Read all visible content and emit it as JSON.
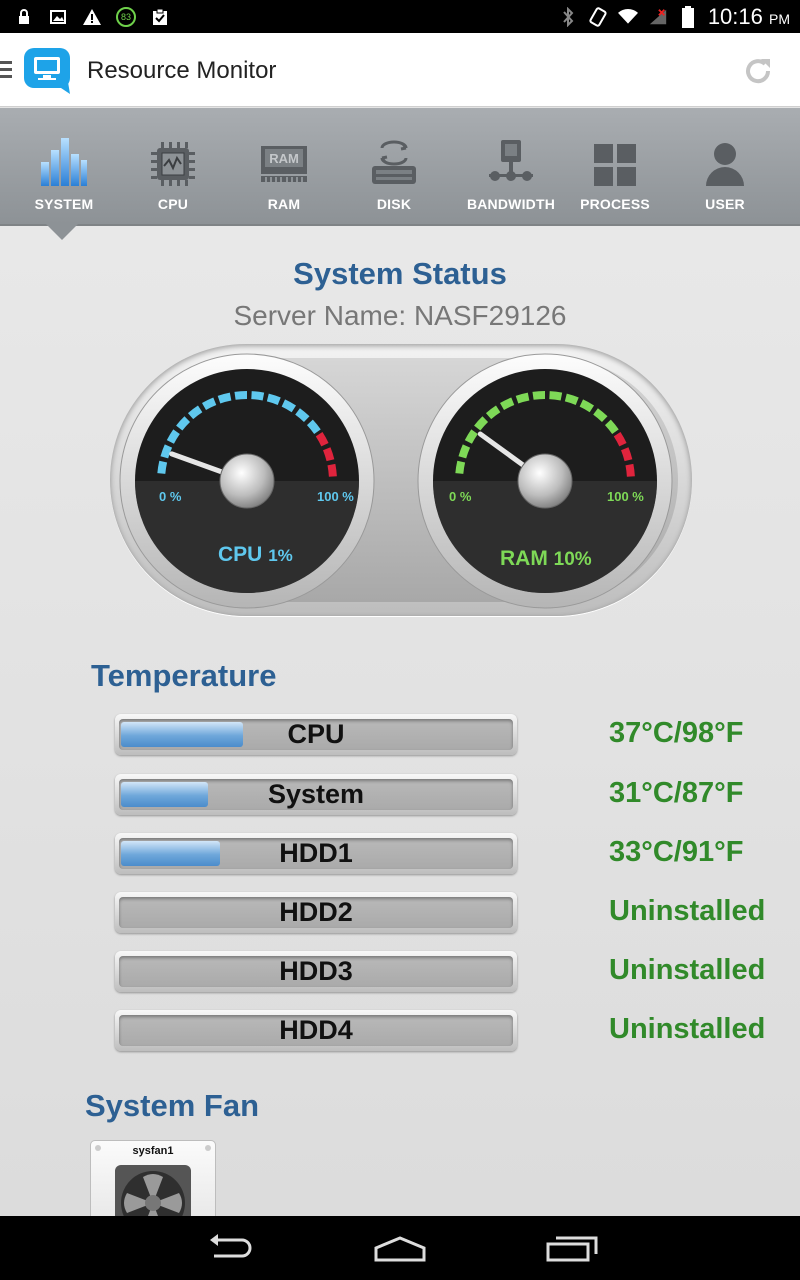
{
  "status_bar": {
    "time": "10:16",
    "ampm": "PM",
    "battery_badge": "83",
    "icons": [
      "lock-icon",
      "image-icon",
      "warning-icon",
      "battery-badge-icon",
      "clipboard-icon",
      "bluetooth-icon",
      "rotate-icon",
      "wifi-icon",
      "signal-icon",
      "battery-icon"
    ]
  },
  "app_bar": {
    "title": "Resource Monitor",
    "icons": [
      "menu-icon",
      "app-logo-icon",
      "refresh-icon"
    ]
  },
  "tabs": [
    {
      "label": "SYSTEM",
      "icon": "bar-chart-icon",
      "active": true
    },
    {
      "label": "CPU",
      "icon": "chip-icon",
      "active": false
    },
    {
      "label": "RAM",
      "icon": "ram-icon",
      "active": false
    },
    {
      "label": "DISK",
      "icon": "disk-icon",
      "active": false
    },
    {
      "label": "BANDWIDTH",
      "icon": "network-icon",
      "active": false
    },
    {
      "label": "PROCESS",
      "icon": "grid-icon",
      "active": false
    },
    {
      "label": "USER",
      "icon": "user-icon",
      "active": false
    }
  ],
  "system_status": {
    "title": "System Status",
    "server_name": "Server Name: NASF29126"
  },
  "gauges": [
    {
      "name": "CPU",
      "percent_text": "1%",
      "value": 1,
      "min_label": "0 %",
      "max_label": "100 %",
      "color": "#5fc8ee"
    },
    {
      "name": "RAM",
      "percent_text": "10%",
      "value": 10,
      "min_label": "0 %",
      "max_label": "100 %",
      "color": "#7ed957"
    }
  ],
  "temperature": {
    "title": "Temperature",
    "rows": [
      {
        "name": "CPU",
        "value": "37°C/98°F",
        "fill": 0.31
      },
      {
        "name": "System",
        "value": "31°C/87°F",
        "fill": 0.22
      },
      {
        "name": "HDD1",
        "value": "33°C/91°F",
        "fill": 0.25
      },
      {
        "name": "HDD2",
        "value": "Uninstalled",
        "fill": 0
      },
      {
        "name": "HDD3",
        "value": "Uninstalled",
        "fill": 0
      },
      {
        "name": "HDD4",
        "value": "Uninstalled",
        "fill": 0
      }
    ]
  },
  "system_fan": {
    "title": "System Fan",
    "fans": [
      {
        "name": "sysfan1"
      }
    ]
  },
  "nav_bar": {
    "icons": [
      "back-icon",
      "home-icon",
      "recents-icon"
    ]
  },
  "colors": {
    "accent_blue": "#2d6093",
    "temp_green": "#318a2a",
    "gauge_red": "#e0243d"
  }
}
